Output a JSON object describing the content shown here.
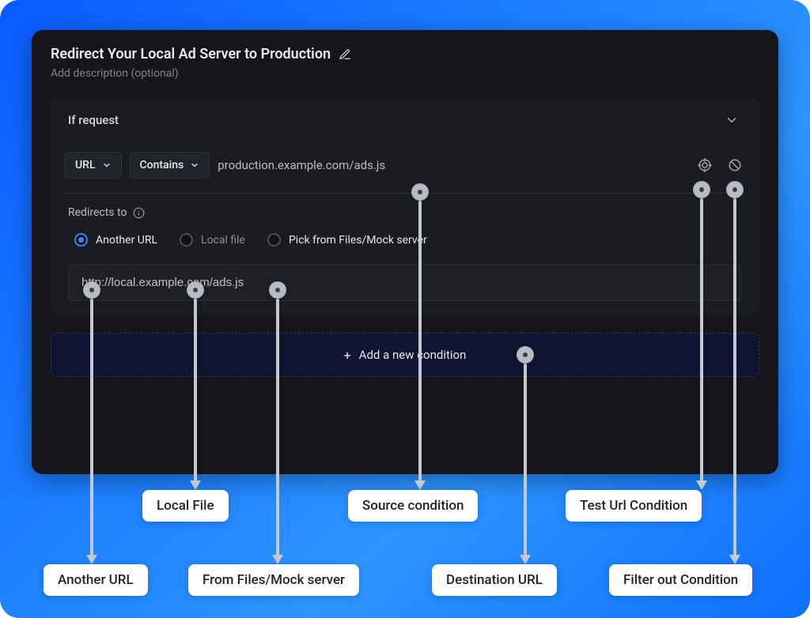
{
  "header": {
    "title": "Redirect Your Local Ad Server to Production",
    "description_placeholder": "Add description (optional)"
  },
  "section": {
    "header_label": "If request",
    "field_type": "URL",
    "operator": "Contains",
    "source_url": "production.example.com/ads.js"
  },
  "redirects": {
    "label": "Redirects to",
    "options": {
      "another_url": "Another URL",
      "local_file": "Local file",
      "mock_server": "Pick from Files/Mock server"
    },
    "selected": "another_url",
    "destination_value": "http://local.example.com/ads.js"
  },
  "actions": {
    "add_condition": "Add a new condition"
  },
  "annotations": {
    "another_url": "Another URL",
    "local_file": "Local File",
    "mock_server": "From Files/Mock server",
    "source_condition": "Source condition",
    "destination_url": "Destination URL",
    "test_url": "Test Url Condition",
    "filter_out": "Filter out Condition"
  }
}
